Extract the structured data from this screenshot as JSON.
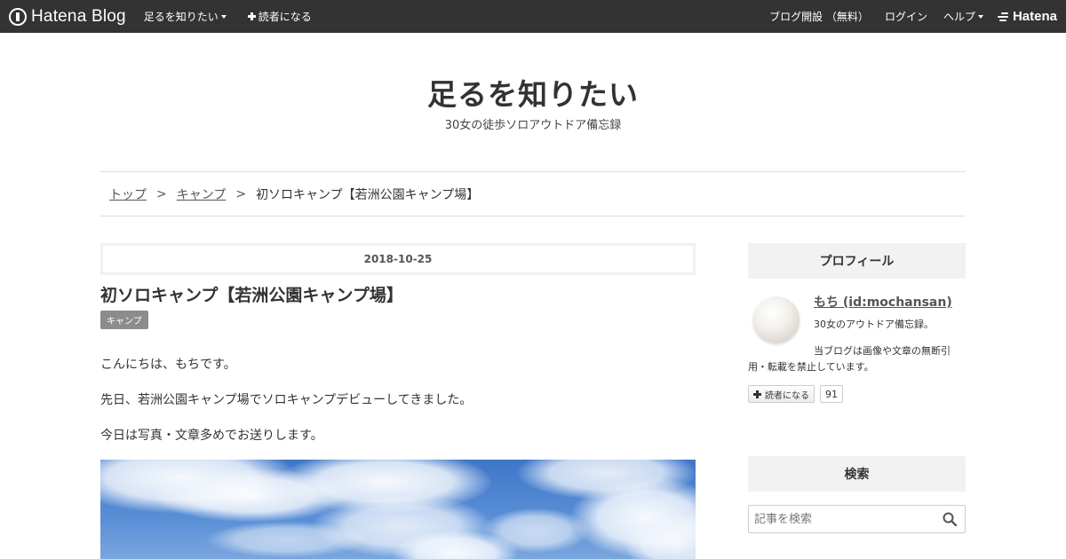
{
  "topbar": {
    "logo_text": "Hatena Blog",
    "blog_name": "足るを知りたい",
    "follow_label": "読者になる",
    "signup_label": "ブログ開設 （無料）",
    "login_label": "ログイン",
    "help_label": "ヘルプ",
    "hatena_label": "Hatena"
  },
  "header": {
    "title": "足るを知りたい",
    "description": "30女の徒歩ソロアウトドア備忘録"
  },
  "breadcrumb": {
    "items": [
      "トップ",
      "キャンプ"
    ],
    "separator": ">",
    "current": "初ソロキャンプ【若洲公園キャンプ場】"
  },
  "article": {
    "date": "2018-10-25",
    "title": "初ソロキャンプ【若洲公園キャンプ場】",
    "category": "キャンプ",
    "paragraphs": [
      "こんにちは、もちです。",
      "先日、若洲公園キャンプ場でソロキャンプデビューしてきました。",
      "今日は写真・文章多めでお送りします。"
    ]
  },
  "sidebar": {
    "profile_heading": "プロフィール",
    "profile_name": "もち (id:mochansan)",
    "profile_desc1": "30女のアウトドア備忘録。",
    "profile_desc2": "当ブログは画像や文章の無断引用・転載を禁止しています。",
    "reader_button": "読者になる",
    "reader_count": "91",
    "search_heading": "検索",
    "search_placeholder": "記事を検索"
  },
  "colors": {
    "topbar_bg": "#333333",
    "sidebar_header_bg": "#f2f2f2",
    "category_tag_bg": "#8c8c8c",
    "sky": "#3f76c8"
  }
}
